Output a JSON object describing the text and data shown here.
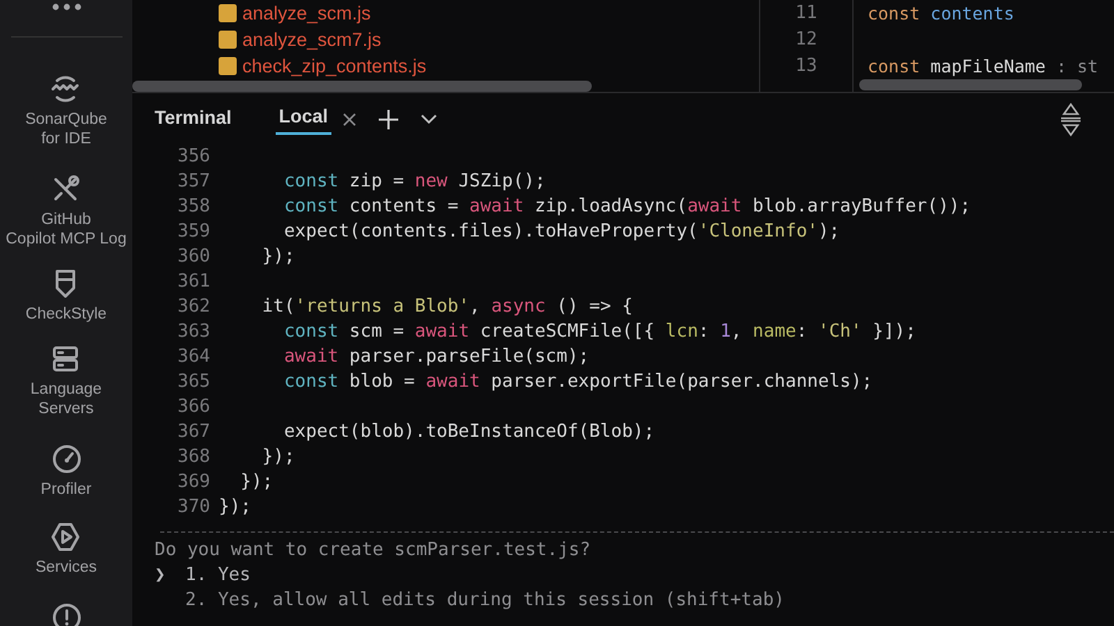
{
  "sidebar": {
    "items": [
      {
        "kind": "icon"
      },
      {
        "kind": "labeled",
        "label_lines": [
          "SonarQube",
          "for IDE"
        ]
      },
      {
        "kind": "labeled",
        "label_lines": [
          "GitHub",
          "Copilot MCP Log"
        ]
      },
      {
        "kind": "labeled",
        "label_lines": [
          "CheckStyle"
        ]
      },
      {
        "kind": "labeled",
        "label_lines": [
          "Language",
          "Servers"
        ]
      },
      {
        "kind": "labeled",
        "label_lines": [
          "Profiler"
        ]
      },
      {
        "kind": "labeled",
        "label_lines": [
          "Services"
        ]
      },
      {
        "kind": "icon"
      }
    ]
  },
  "file_tree": {
    "files": [
      {
        "name": "analyze_scm.js"
      },
      {
        "name": "analyze_scm7.js"
      },
      {
        "name": "check_zip_contents.js"
      }
    ]
  },
  "editor": {
    "lines": [
      {
        "number": "11",
        "tokens": [
          {
            "kind": "keyword",
            "text": "const"
          },
          {
            "kind": "variable",
            "text": " contents"
          }
        ]
      },
      {
        "number": "12"
      },
      {
        "number": "13",
        "tokens": [
          {
            "kind": "keyword",
            "text": "const"
          },
          {
            "kind": "plain",
            "text": " mapFileName"
          },
          {
            "kind": "hint",
            "text": " : st"
          }
        ]
      }
    ]
  },
  "terminal": {
    "title": "Terminal",
    "tabs": [
      {
        "label": "Local",
        "selected": true
      }
    ],
    "lines": [
      {
        "number": "356"
      },
      {
        "number": "357",
        "tokens": [
          {
            "kind": "decl",
            "text": "      const"
          },
          {
            "kind": "plain",
            "text": " zip = "
          },
          {
            "kind": "kw",
            "text": "new"
          },
          {
            "kind": "plain",
            "text": " JSZip();"
          }
        ]
      },
      {
        "number": "358",
        "tokens": [
          {
            "kind": "decl",
            "text": "      const"
          },
          {
            "kind": "plain",
            "text": " contents = "
          },
          {
            "kind": "kw",
            "text": "await"
          },
          {
            "kind": "plain",
            "text": " zip.loadAsync("
          },
          {
            "kind": "kw",
            "text": "await"
          },
          {
            "kind": "plain",
            "text": " blob.arrayBuffer());"
          }
        ]
      },
      {
        "number": "359",
        "tokens": [
          {
            "kind": "plain",
            "text": "      expect(contents.files).toHaveProperty("
          },
          {
            "kind": "string",
            "text": "'CloneInfo'"
          },
          {
            "kind": "plain",
            "text": ");"
          }
        ]
      },
      {
        "number": "360",
        "tokens": [
          {
            "kind": "plain",
            "text": "    });"
          }
        ]
      },
      {
        "number": "361"
      },
      {
        "number": "362",
        "tokens": [
          {
            "kind": "plain",
            "text": "    it("
          },
          {
            "kind": "string",
            "text": "'returns a Blob'"
          },
          {
            "kind": "plain",
            "text": ", "
          },
          {
            "kind": "kw",
            "text": "async"
          },
          {
            "kind": "plain",
            "text": " () => {"
          }
        ]
      },
      {
        "number": "363",
        "tokens": [
          {
            "kind": "decl",
            "text": "      const"
          },
          {
            "kind": "plain",
            "text": " scm = "
          },
          {
            "kind": "kw",
            "text": "await"
          },
          {
            "kind": "plain",
            "text": " createSCMFile([{ "
          },
          {
            "kind": "prop",
            "text": "lcn"
          },
          {
            "kind": "plain",
            "text": ": "
          },
          {
            "kind": "number",
            "text": "1"
          },
          {
            "kind": "plain",
            "text": ", "
          },
          {
            "kind": "prop",
            "text": "name"
          },
          {
            "kind": "plain",
            "text": ": "
          },
          {
            "kind": "string",
            "text": "'Ch'"
          },
          {
            "kind": "plain",
            "text": " }]);"
          }
        ]
      },
      {
        "number": "364",
        "tokens": [
          {
            "kind": "kw",
            "text": "      await"
          },
          {
            "kind": "plain",
            "text": " parser.parseFile(scm);"
          }
        ]
      },
      {
        "number": "365",
        "tokens": [
          {
            "kind": "decl",
            "text": "      const"
          },
          {
            "kind": "plain",
            "text": " blob = "
          },
          {
            "kind": "kw",
            "text": "await"
          },
          {
            "kind": "plain",
            "text": " parser.exportFile(parser.channels);"
          }
        ]
      },
      {
        "number": "366"
      },
      {
        "number": "367",
        "tokens": [
          {
            "kind": "plain",
            "text": "      expect(blob).toBeInstanceOf(Blob);"
          }
        ]
      },
      {
        "number": "368",
        "tokens": [
          {
            "kind": "plain",
            "text": "    });"
          }
        ]
      },
      {
        "number": "369",
        "tokens": [
          {
            "kind": "plain",
            "text": "  });"
          }
        ]
      },
      {
        "number": "370",
        "tokens": [
          {
            "kind": "plain",
            "text": "});"
          }
        ]
      }
    ],
    "prompt": {
      "question": "Do you want to create scmParser.test.js?",
      "pointer": "❯",
      "options": [
        {
          "label": "1. Yes",
          "selected": true
        },
        {
          "label": "2. Yes, allow all edits during this session (shift+tab)",
          "selected": false
        }
      ]
    }
  }
}
